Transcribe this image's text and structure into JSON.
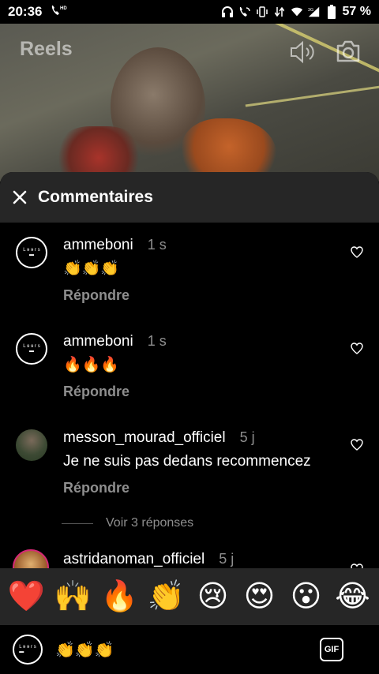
{
  "status_bar": {
    "time": "20:36",
    "call_indicator": "HD",
    "battery_percent": "57 %",
    "icons": [
      "phone-hd-icon",
      "headphones-icon",
      "wifi-call-icon",
      "vibrate-icon",
      "data-arrows-icon",
      "wifi-icon",
      "signal-icon",
      "battery-icon"
    ]
  },
  "video": {
    "title": "Reels",
    "icons": [
      "speaker-icon",
      "camera-icon"
    ]
  },
  "sheet": {
    "title": "Commentaires",
    "close_icon": "close-icon"
  },
  "comments": [
    {
      "user": "ammeboni",
      "time": "1 s",
      "text": "👏👏👏",
      "reply_label": "Répondre",
      "avatar": "logo"
    },
    {
      "user": "ammeboni",
      "time": "1 s",
      "text": "🔥🔥🔥",
      "reply_label": "Répondre",
      "avatar": "logo"
    },
    {
      "user": "messon_mourad_officiel",
      "time": "5 j",
      "text": "Je ne suis pas dedans recommencez",
      "reply_label": "Répondre",
      "avatar": "photo",
      "view_replies": "Voir 3 réponses"
    },
    {
      "user": "astridanoman_officiel",
      "time": "5 j",
      "avatar": "story"
    }
  ],
  "emoji_bar": [
    "❤️",
    "🙌",
    "🔥",
    "👏",
    "😢",
    "😍",
    "😮",
    "😂"
  ],
  "input": {
    "value": "👏👏👏",
    "gif_label": "GIF"
  },
  "colors": {
    "background": "#000000",
    "sheet_header": "#262626",
    "secondary_text": "#8e8e8e",
    "story_ring": "#d62976"
  }
}
